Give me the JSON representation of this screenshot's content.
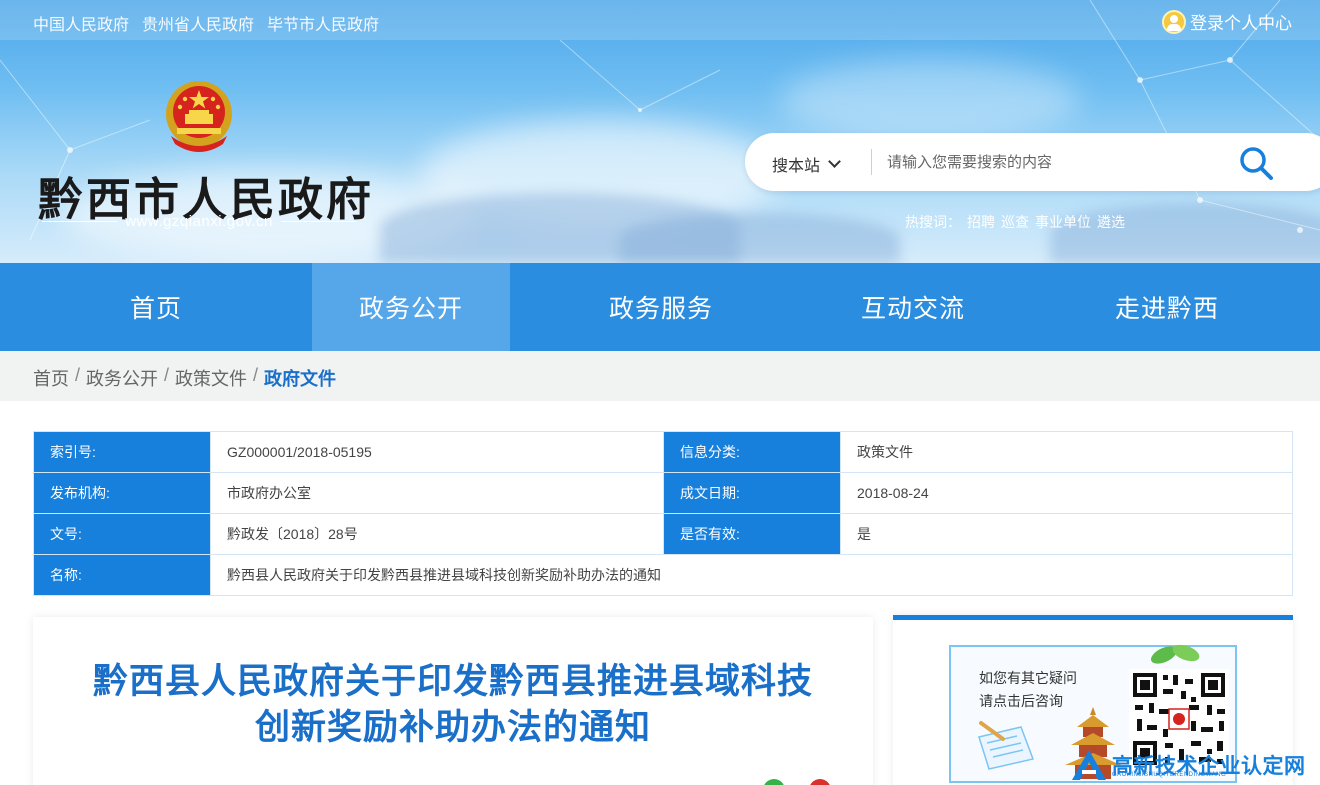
{
  "topbar": {
    "links": [
      "中国人民政府",
      "贵州省人民政府",
      "毕节市人民政府"
    ],
    "login_label": "登录个人中心"
  },
  "site": {
    "name": "黔西市人民政府",
    "url": "www.gzqianxi.gov.cn"
  },
  "search": {
    "scope_label": "搜本站",
    "placeholder": "请输入您需要搜索的内容",
    "hot_label": "热搜词：",
    "hot_words": [
      "招聘",
      "巡查",
      "事业单位",
      "遴选"
    ]
  },
  "nav": {
    "items": [
      "首页",
      "政务公开",
      "政务服务",
      "互动交流",
      "走进黔西"
    ],
    "active": "政务公开"
  },
  "breadcrumb": {
    "items": [
      "首页",
      "政务公开",
      "政策文件"
    ],
    "current": "政府文件",
    "separator": "/"
  },
  "info": {
    "index_label": "索引号:",
    "index_value": "GZ000001/2018-05195",
    "category_label": "信息分类:",
    "category_value": "政策文件",
    "publisher_label": "发布机构:",
    "publisher_value": "市政府办公室",
    "date_label": "成文日期:",
    "date_value": "2018-08-24",
    "docno_label": "文号:",
    "docno_value": "黔政发〔2018〕28号",
    "valid_label": "是否有效:",
    "valid_value": "是",
    "title_label": "名称:",
    "title_value": "黔西县人民政府关于印发黔西县推进县域科技创新奖励补助办法的通知"
  },
  "article": {
    "title_line1": "黔西县人民政府关于印发黔西县推进县域科技",
    "title_line2": "创新奖励补助办法的通知"
  },
  "side": {
    "consult_line1": "如您有其它疑问",
    "consult_line2": "请点击后咨询"
  },
  "watermark": {
    "main": "高新技术企业认定网",
    "sub": "GAOXINJISHUQIYERENDINGWANG"
  },
  "colors": {
    "nav_bg": "#2b8de0",
    "nav_active": "#55a7ea",
    "table_label_bg": "#1780dc",
    "title_blue": "#1a6fc9"
  }
}
